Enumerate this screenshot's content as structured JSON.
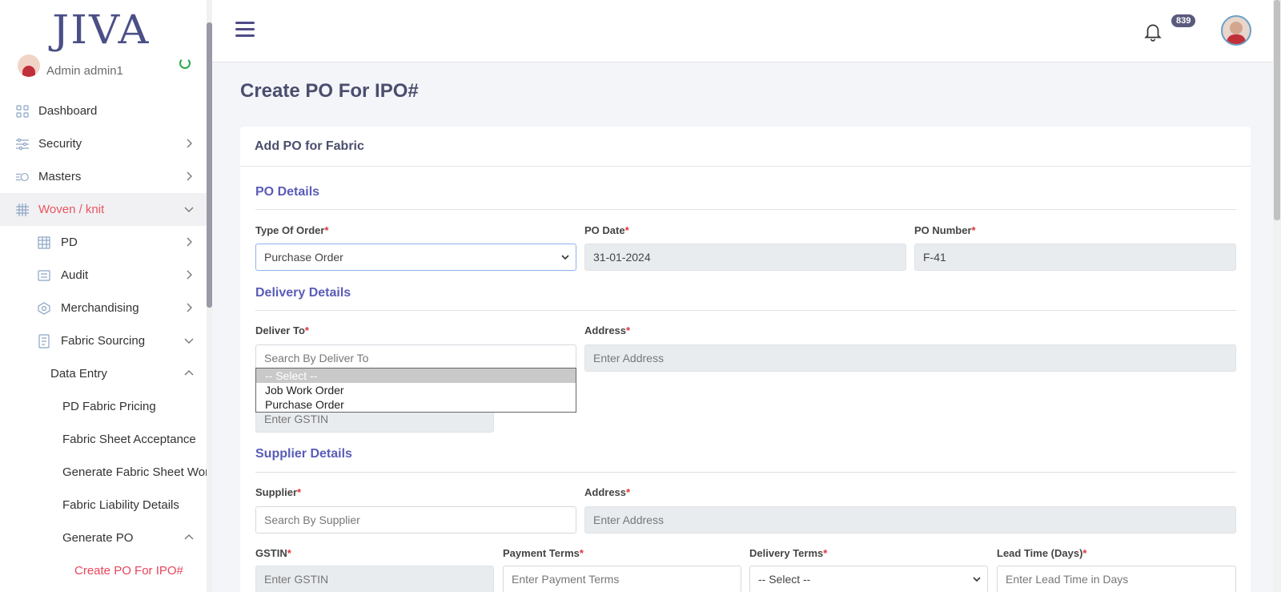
{
  "app": {
    "logo_text": "JIVA"
  },
  "user": {
    "name": "Admin admin1"
  },
  "sidebar": {
    "items": [
      {
        "label": "Dashboard"
      },
      {
        "label": "Security"
      },
      {
        "label": "Masters"
      },
      {
        "label": "Woven / knit"
      },
      {
        "label": "PD"
      },
      {
        "label": "Audit"
      },
      {
        "label": "Merchandising"
      },
      {
        "label": "Fabric Sourcing"
      },
      {
        "label": "Data Entry"
      },
      {
        "label": "PD Fabric Pricing"
      },
      {
        "label": "Fabric Sheet Acceptance"
      },
      {
        "label": "Generate Fabric Sheet Working"
      },
      {
        "label": "Fabric Liability Details"
      },
      {
        "label": "Generate PO"
      },
      {
        "label": "Create PO For IPO#"
      }
    ]
  },
  "topbar": {
    "notification_count": "839"
  },
  "page": {
    "title": "Create PO For IPO#"
  },
  "card": {
    "title": "Add PO for Fabric"
  },
  "po_details": {
    "section": "PO Details",
    "type_label": "Type Of Order",
    "type_value": "Purchase Order",
    "date_label": "PO Date",
    "date_value": "31-01-2024",
    "number_label": "PO Number",
    "number_value": "F-41"
  },
  "delivery": {
    "section": "Delivery Details",
    "deliver_to_label": "Deliver To",
    "deliver_to_placeholder": "Search By Deliver To",
    "address_label": "Address",
    "address_placeholder": "Enter Address",
    "gstin_placeholder": "Enter GSTIN"
  },
  "dropdown": {
    "options": [
      "-- Select --",
      "Job Work Order",
      "Purchase Order"
    ]
  },
  "supplier": {
    "section": "Supplier Details",
    "supplier_label": "Supplier",
    "supplier_placeholder": "Search By Supplier",
    "address_label": "Address",
    "address_placeholder": "Enter Address",
    "gstin_label": "GSTIN",
    "gstin_placeholder": "Enter GSTIN",
    "payment_label": "Payment Terms",
    "payment_placeholder": "Enter Payment Terms",
    "delivery_terms_label": "Delivery Terms",
    "delivery_terms_value": "-- Select --",
    "lead_time_label": "Lead Time (Days)",
    "lead_time_placeholder": "Enter Lead Time in Days"
  },
  "required_mark": "*"
}
